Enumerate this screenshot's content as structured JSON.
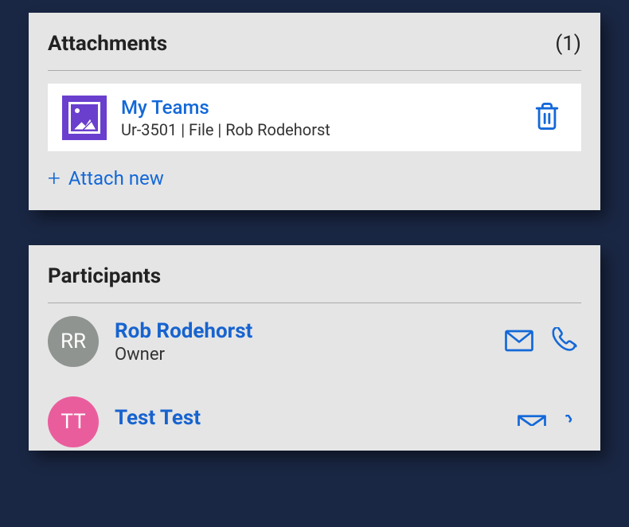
{
  "attachments": {
    "title": "Attachments",
    "count": "(1)",
    "items": [
      {
        "title": "My Teams",
        "meta": "Ur-3501 | File | Rob Rodehorst"
      }
    ],
    "attach_new_label": "Attach new"
  },
  "participants": {
    "title": "Participants",
    "items": [
      {
        "initials": "RR",
        "name": "Rob Rodehorst",
        "role": "Owner",
        "avatar_color": "grey"
      },
      {
        "initials": "TT",
        "name": "Test Test",
        "role": "",
        "avatar_color": "pink"
      }
    ]
  }
}
